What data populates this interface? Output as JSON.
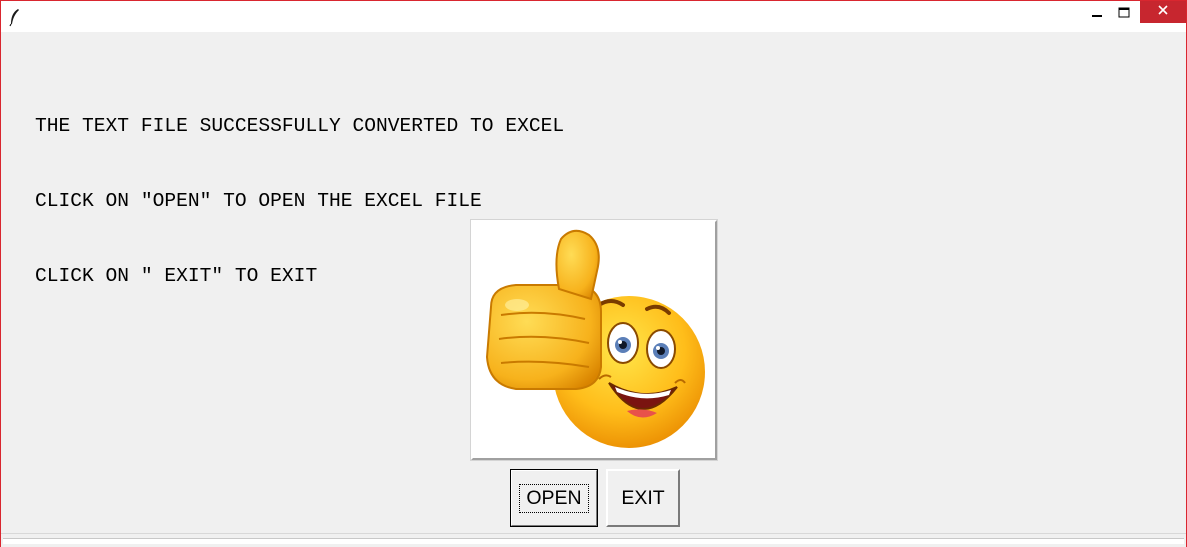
{
  "window": {
    "title": "",
    "controls": {
      "minimize_icon": "minimize-icon",
      "maximize_icon": "maximize-icon",
      "close_icon": "close-icon"
    },
    "close_color": "#c7262f"
  },
  "message": {
    "lines": [
      "THE TEXT FILE SUCCESSFULLY CONVERTED TO EXCEL",
      "CLICK ON \"OPEN\" TO OPEN THE EXCEL FILE",
      "CLICK ON \" EXIT\" TO EXIT"
    ]
  },
  "image": {
    "icon": "thumbs-up-smiley-icon"
  },
  "buttons": {
    "open_label": "OPEN",
    "exit_label": "EXIT"
  }
}
